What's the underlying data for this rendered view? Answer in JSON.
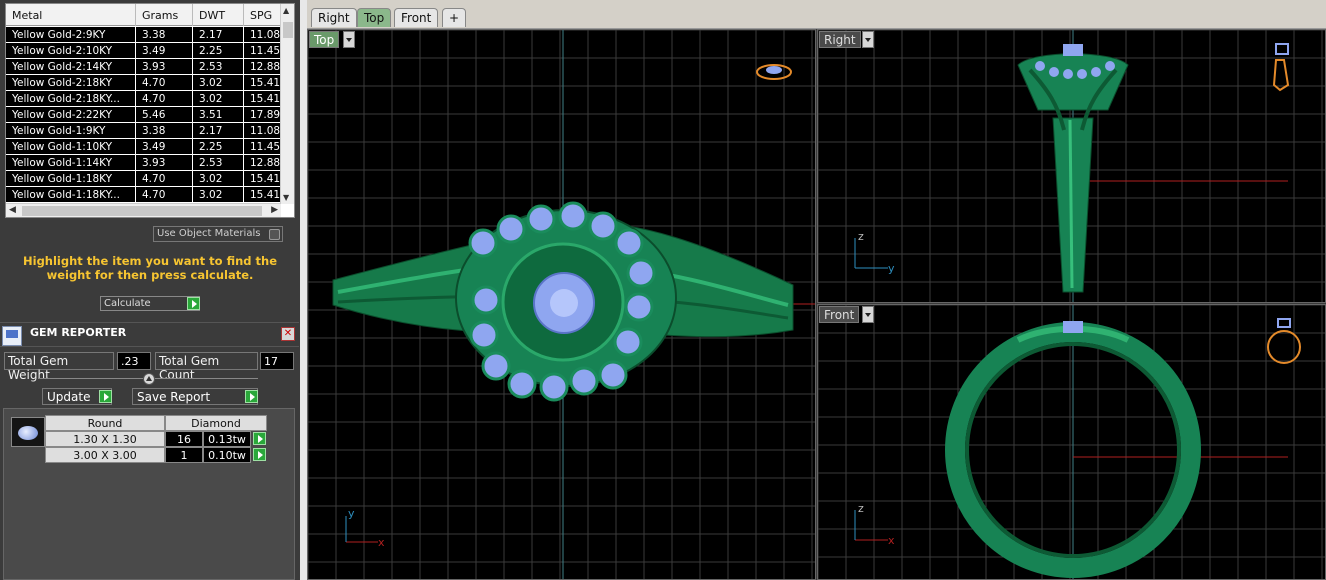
{
  "metal_table": {
    "headers": [
      "Metal",
      "Grams",
      "DWT",
      "SPG"
    ],
    "rows": [
      [
        "Yellow Gold-2:9KY",
        "3.38",
        "2.17",
        "11.08"
      ],
      [
        "Yellow Gold-2:10KY",
        "3.49",
        "2.25",
        "11.45"
      ],
      [
        "Yellow Gold-2:14KY",
        "3.93",
        "2.53",
        "12.88"
      ],
      [
        "Yellow Gold-2:18KY",
        "4.70",
        "3.02",
        "15.41"
      ],
      [
        "Yellow Gold-2:18KY...",
        "4.70",
        "3.02",
        "15.41"
      ],
      [
        "Yellow Gold-2:22KY",
        "5.46",
        "3.51",
        "17.89"
      ],
      [
        "Yellow Gold-1:9KY",
        "3.38",
        "2.17",
        "11.08"
      ],
      [
        "Yellow Gold-1:10KY",
        "3.49",
        "2.25",
        "11.45"
      ],
      [
        "Yellow Gold-1:14KY",
        "3.93",
        "2.53",
        "12.88"
      ],
      [
        "Yellow Gold-1:18KY",
        "4.70",
        "3.02",
        "15.41"
      ],
      [
        "Yellow Gold-1:18KY...",
        "4.70",
        "3.02",
        "15.41"
      ]
    ]
  },
  "use_object_materials": "Use Object Materials",
  "hint": "Highlight the item you want to find the weight for then press calculate.",
  "calculate_label": "Calculate",
  "gem_reporter": {
    "title": "GEM REPORTER",
    "close_glyph": "✕",
    "total_weight_label": "Total Gem Weight",
    "total_weight_value": ".23",
    "total_count_label": "Total Gem Count",
    "total_count_value": "17",
    "update_label": "Update",
    "save_report_label": "Save Report",
    "shape_header": "Round",
    "stone_header": "Diamond",
    "rows": [
      {
        "size": "1.30 X 1.30",
        "count": "16",
        "weight": "0.13tw"
      },
      {
        "size": "3.00 X 3.00",
        "count": "1",
        "weight": "0.10tw"
      }
    ]
  },
  "tabs": {
    "right": "Right",
    "top": "Top",
    "front": "Front",
    "add": "+"
  },
  "viewports": {
    "top_label": "Top",
    "right_label": "Right",
    "front_label": "Front",
    "axis_y": "y",
    "axis_x": "x",
    "axis_z": "z"
  },
  "colors": {
    "ring_green": "#1f8f5c",
    "gem_blue": "#8fa6f0",
    "hint_yellow": "#f7c531",
    "accent_green": "#2aa83a"
  }
}
